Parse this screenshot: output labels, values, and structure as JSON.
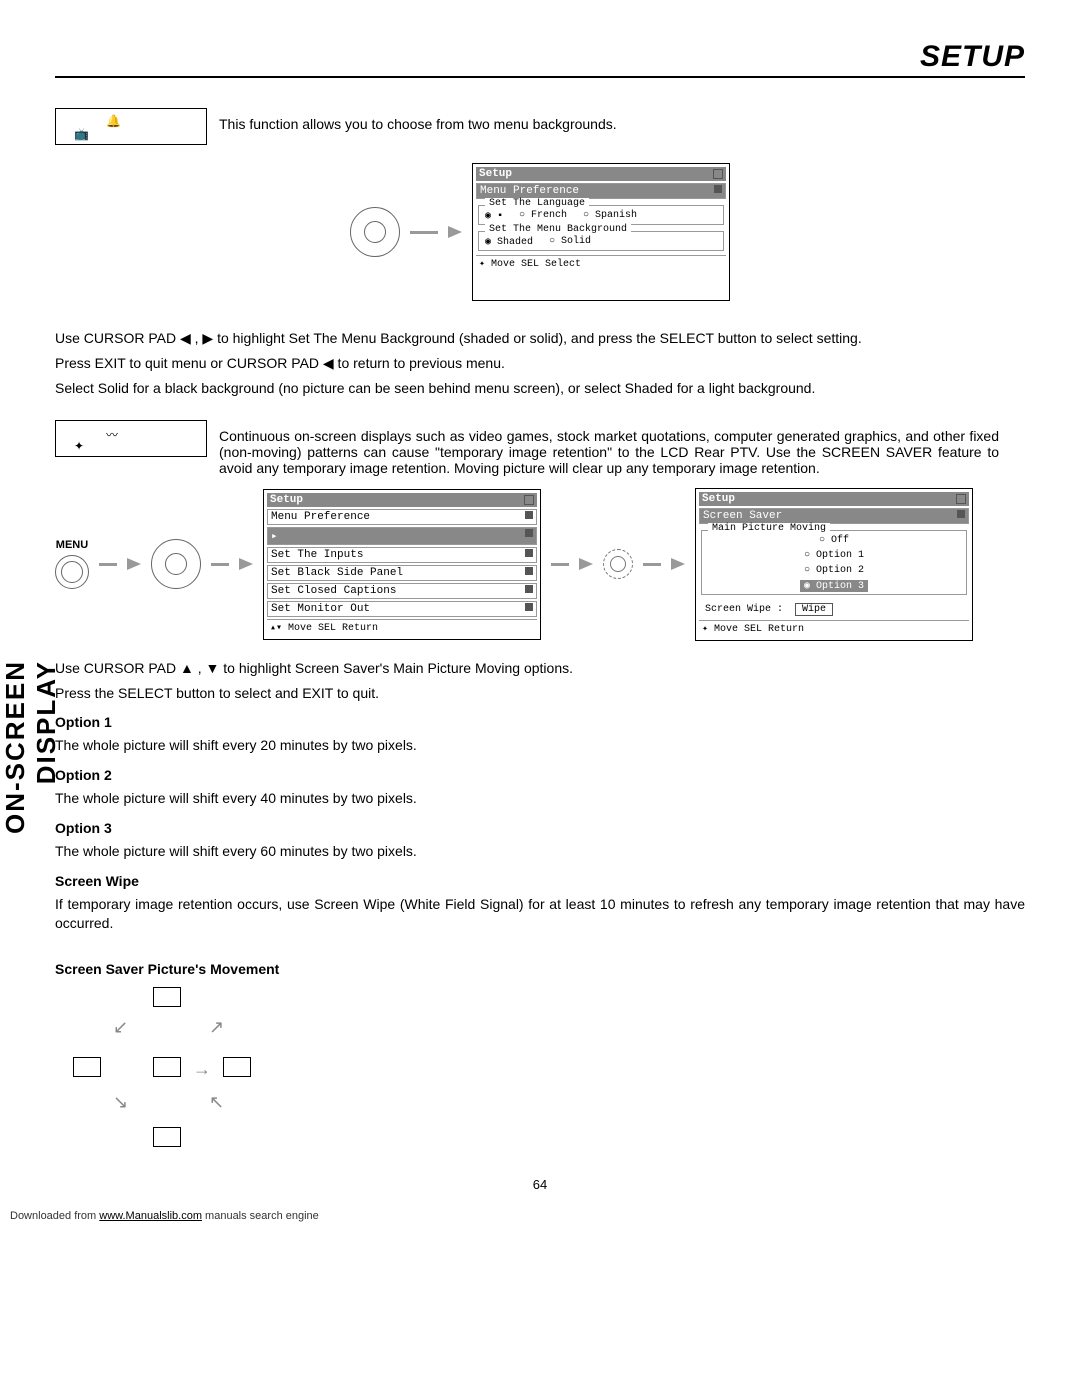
{
  "header": {
    "title": "SETUP"
  },
  "menuBackground": {
    "intro": "This function allows you to choose from two menu backgrounds.",
    "screenshot": {
      "title": "Setup",
      "subtitle": "Menu Preference",
      "group1": {
        "legend": "Set The Language",
        "opt1": "◉ ▪",
        "opt2": "○ French",
        "opt3": "○ Spanish"
      },
      "group2": {
        "legend": "Set The Menu Background",
        "opt1": "◉ Shaded",
        "opt2": "○ Solid"
      },
      "footer": "✦ Move  SEL Select"
    },
    "instr1": "Use CURSOR PAD ◀ , ▶ to highlight Set The Menu Background (shaded or solid), and press the SELECT button to select setting.",
    "instr2": "Press EXIT to quit menu or CURSOR PAD ◀ to return to previous menu.",
    "instr3": "Select Solid for a black background (no picture can be seen behind menu screen), or select Shaded for a light background."
  },
  "screenSaver": {
    "intro": "Continuous on-screen displays such as video games, stock market quotations, computer generated graphics, and other fixed (non-moving) patterns can cause \"temporary image retention\" to the LCD Rear PTV.  Use the SCREEN SAVER feature to avoid any temporary image retention.  Moving picture will clear up any temporary image retention.",
    "menuLabel": "MENU",
    "screenshot1": {
      "title": "Setup",
      "rows": [
        "Menu Preference",
        "▸",
        "Set The Inputs",
        "Set Black Side Panel",
        "Set Closed Captions",
        "Set Monitor Out"
      ],
      "footer": "▴▾ Move  SEL Return"
    },
    "screenshot2": {
      "title": "Setup",
      "subtitle": "Screen Saver",
      "groupLegend": "Main Picture Moving",
      "opts": [
        "○ Off",
        "○ Option 1",
        "○ Option 2",
        "◉ Option 3"
      ],
      "wipeLabel": "Screen Wipe :",
      "wipeBtn": "Wipe",
      "footer": "✦ Move  SEL Return"
    },
    "instr1": "Use CURSOR PAD ▲ , ▼ to highlight Screen Saver's Main Picture Moving options.",
    "instr2": "Press the SELECT button to select and EXIT to quit.",
    "opt1h": "Option 1",
    "opt1t": "The whole picture will shift every 20 minutes by two pixels.",
    "opt2h": "Option 2",
    "opt2t": "The whole picture will shift every 40 minutes by two pixels.",
    "opt3h": "Option 3",
    "opt3t": "The whole picture will shift every 60 minutes by two pixels.",
    "wipeh": "Screen Wipe",
    "wipet": "If temporary image retention occurs, use Screen Wipe (White Field Signal) for at least 10 minutes to refresh any temporary image retention that may have occurred.",
    "movementH": "Screen Saver Picture's Movement"
  },
  "sideLabel": "ON-SCREEN DISPLAY",
  "pageNum": "64",
  "footer": {
    "prefix": "Downloaded from ",
    "link": "www.Manualslib.com",
    "suffix": "  manuals search engine"
  }
}
